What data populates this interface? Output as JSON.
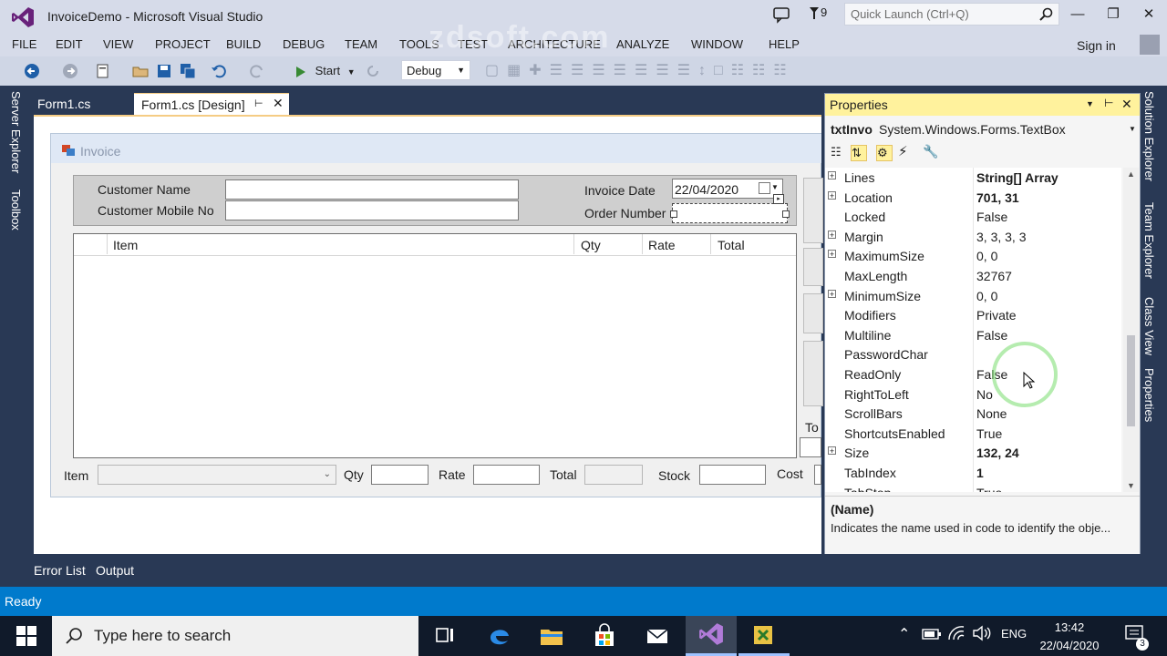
{
  "window": {
    "title": "InvoiceDemo - Microsoft Visual Studio",
    "notification_count": "9",
    "quick_launch_placeholder": "Quick Launch (Ctrl+Q)",
    "sign_in": "Sign in"
  },
  "menu": [
    "FILE",
    "EDIT",
    "VIEW",
    "PROJECT",
    "BUILD",
    "DEBUG",
    "TEAM",
    "TOOLS",
    "TEST",
    "ARCHITECTURE",
    "ANALYZE",
    "WINDOW",
    "HELP"
  ],
  "toolbar": {
    "start_label": "Start",
    "config": "Debug"
  },
  "side_tabs": {
    "left": [
      "Server Explorer",
      "Toolbox"
    ],
    "right": [
      "Solution Explorer",
      "Team Explorer",
      "Class View",
      "Properties"
    ]
  },
  "doc_tabs": [
    "Form1.cs",
    "Form1.cs [Design]"
  ],
  "form": {
    "title": "Invoice",
    "customer_name_label": "Customer Name",
    "customer_mobile_label": "Customer Mobile No",
    "invoice_date_label": "Invoice Date",
    "invoice_date_value": "22/04/2020",
    "order_number_label": "Order Number",
    "grid_columns": [
      "Item",
      "Qty",
      "Rate",
      "Total"
    ],
    "bottom_labels": {
      "item": "Item",
      "qty": "Qty",
      "rate": "Rate",
      "total": "Total",
      "stock": "Stock",
      "cost": "Cost",
      "to": "To"
    }
  },
  "properties": {
    "title": "Properties",
    "object_name": "txtInvo",
    "object_type": "System.Windows.Forms.TextBox",
    "rows": [
      {
        "name": "Lines",
        "value": "String[] Array",
        "expand": true,
        "bold": true
      },
      {
        "name": "Location",
        "value": "701, 31",
        "expand": true,
        "bold": true
      },
      {
        "name": "Locked",
        "value": "False",
        "expand": false,
        "bold": false
      },
      {
        "name": "Margin",
        "value": "3, 3, 3, 3",
        "expand": true,
        "bold": false
      },
      {
        "name": "MaximumSize",
        "value": "0, 0",
        "expand": true,
        "bold": false
      },
      {
        "name": "MaxLength",
        "value": "32767",
        "expand": false,
        "bold": false
      },
      {
        "name": "MinimumSize",
        "value": "0, 0",
        "expand": true,
        "bold": false
      },
      {
        "name": "Modifiers",
        "value": "Private",
        "expand": false,
        "bold": false
      },
      {
        "name": "Multiline",
        "value": "False",
        "expand": false,
        "bold": false
      },
      {
        "name": "PasswordChar",
        "value": "",
        "expand": false,
        "bold": false
      },
      {
        "name": "ReadOnly",
        "value": "False",
        "expand": false,
        "bold": false
      },
      {
        "name": "RightToLeft",
        "value": "No",
        "expand": false,
        "bold": false
      },
      {
        "name": "ScrollBars",
        "value": "None",
        "expand": false,
        "bold": false
      },
      {
        "name": "ShortcutsEnabled",
        "value": "True",
        "expand": false,
        "bold": false
      },
      {
        "name": "Size",
        "value": "132, 24",
        "expand": true,
        "bold": true
      },
      {
        "name": "TabIndex",
        "value": "1",
        "expand": false,
        "bold": true
      },
      {
        "name": "TabStop",
        "value": "True",
        "expand": false,
        "bold": false
      }
    ],
    "desc_name": "(Name)",
    "desc_text": "Indicates the name used in code to identify the obje..."
  },
  "bottom_tabs": [
    "Error List",
    "Output"
  ],
  "status": "Ready",
  "taskbar": {
    "search_placeholder": "Type here to search",
    "lang": "ENG",
    "time": "13:42",
    "date": "22/04/2020",
    "notif_count": "3"
  },
  "watermark": "zdsoft.com",
  "colors": {
    "accent": "#007acc",
    "vs_purple": "#68217a",
    "titlebar": "#d6dbe9",
    "chrome_dark": "#293955",
    "props_header": "#fff29d"
  }
}
